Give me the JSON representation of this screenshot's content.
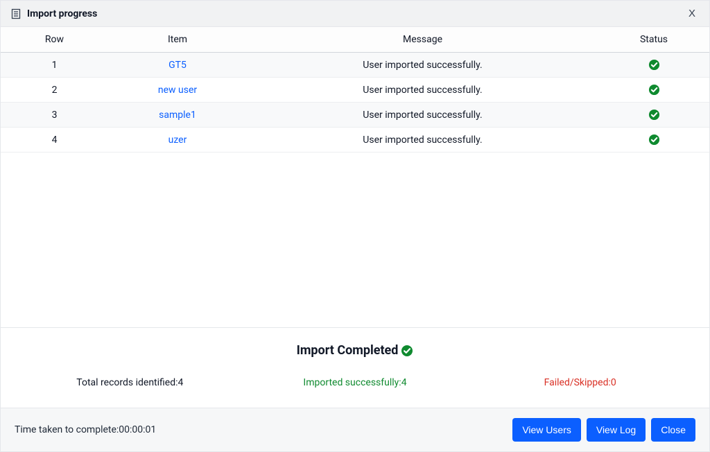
{
  "title": "Import progress",
  "close_label": "X",
  "columns": {
    "row": "Row",
    "item": "Item",
    "message": "Message",
    "status": "Status"
  },
  "rows": [
    {
      "row": "1",
      "item": "GT5",
      "message": "User imported successfully.",
      "status": "ok"
    },
    {
      "row": "2",
      "item": "new user",
      "message": "User imported successfully.",
      "status": "ok"
    },
    {
      "row": "3",
      "item": "sample1",
      "message": "User imported successfully.",
      "status": "ok"
    },
    {
      "row": "4",
      "item": "uzer",
      "message": "User imported successfully.",
      "status": "ok"
    }
  ],
  "summary": {
    "title": "Import Completed",
    "total_label": "Total records identified:",
    "total_value": "4",
    "ok_label": "Imported successfully:",
    "ok_value": "4",
    "fail_label": "Failed/Skipped:",
    "fail_value": "0"
  },
  "footer": {
    "time_label": "Time taken to complete:",
    "time_value": "00:00:01",
    "buttons": {
      "view_users": "View Users",
      "view_log": "View Log",
      "close": "Close"
    }
  }
}
